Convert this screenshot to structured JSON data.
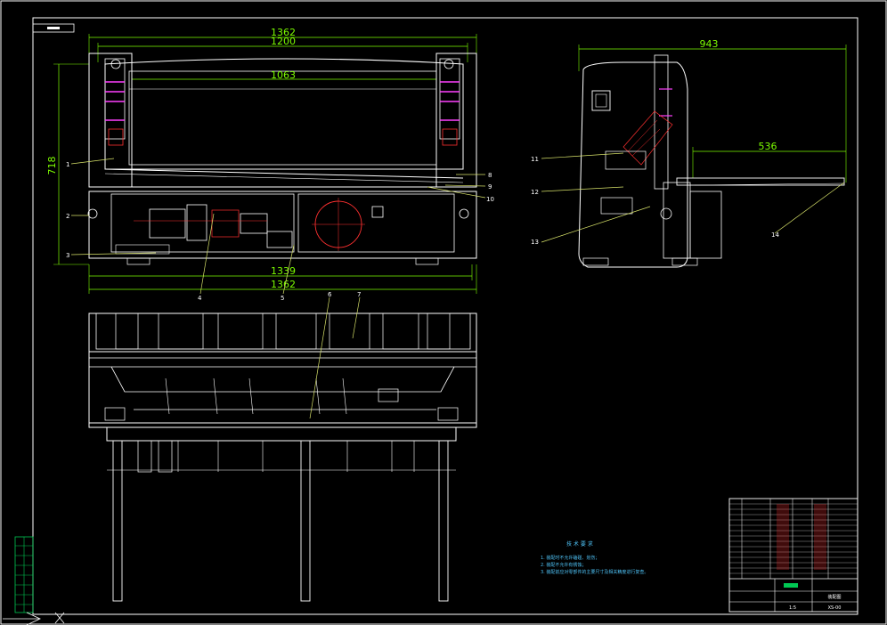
{
  "dimensions": {
    "front_top_overall": "1362",
    "front_top_inner": "1200",
    "front_blade": "1063",
    "front_height": "718",
    "front_bottom_inner": "1339",
    "front_bottom_overall": "1362",
    "side_overall": "943",
    "side_table": "536"
  },
  "part_labels": {
    "p1": "1",
    "p2": "2",
    "p3": "3",
    "p4": "4",
    "p5": "5",
    "p6": "6",
    "p7": "7",
    "p8": "8",
    "p9": "9",
    "p10": "10",
    "p11": "11",
    "p12": "12",
    "p13": "13",
    "p14": "14"
  },
  "notes": {
    "title": "技 术 要 求",
    "lines": [
      "1. 装配时不允许磕碰、划伤；",
      "2. 装配不允许有锈蚀；",
      "3. 装配前应对零部件的主要尺寸及相关精度进行复查。"
    ]
  },
  "title_block": {
    "drawing_name": "装配图",
    "code": "XS-00",
    "scale": "1:5"
  },
  "colors": {
    "frame": "#ffffff",
    "dimension": "#7CFC00",
    "leader": "#d8e36a",
    "hidden": "#ff40ff",
    "notes": "#4fc3f7",
    "titleblock_red": "#ff3030",
    "sidebar_green": "#00c853"
  }
}
